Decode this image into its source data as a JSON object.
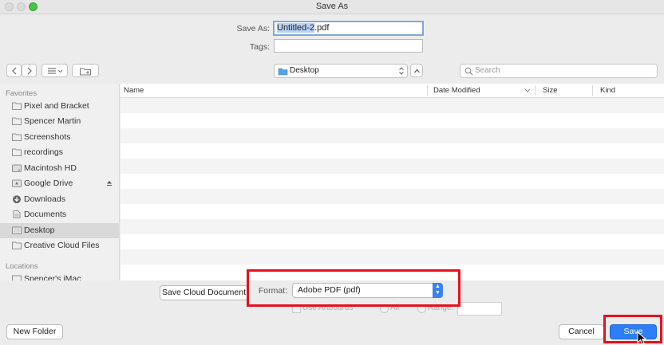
{
  "window": {
    "title": "Save As"
  },
  "save_as": {
    "label": "Save As:",
    "value_selected": "Untitled-2",
    "value_rest": ".pdf"
  },
  "tags": {
    "label": "Tags:",
    "value": ""
  },
  "toolbar": {
    "location": "Desktop",
    "search_placeholder": "Search"
  },
  "sidebar": {
    "favorites_header": "Favorites",
    "locations_header": "Locations",
    "favorites": [
      {
        "label": "Pixel and Bracket",
        "icon": "folder-icon"
      },
      {
        "label": "Spencer Martin",
        "icon": "folder-icon"
      },
      {
        "label": "Screenshots",
        "icon": "folder-icon"
      },
      {
        "label": "recordings",
        "icon": "folder-icon"
      },
      {
        "label": "Macintosh HD",
        "icon": "disk-icon"
      },
      {
        "label": "Google Drive",
        "icon": "drive-icon"
      },
      {
        "label": "Downloads",
        "icon": "download-icon"
      },
      {
        "label": "Documents",
        "icon": "document-icon"
      },
      {
        "label": "Desktop",
        "icon": "desktop-icon",
        "selected": true
      },
      {
        "label": "Creative Cloud Files",
        "icon": "folder-icon"
      }
    ],
    "locations": [
      {
        "label": "Spencer's iMac",
        "icon": "computer-icon"
      }
    ]
  },
  "columns": {
    "name": "Name",
    "date_modified": "Date Modified",
    "size": "Size",
    "kind": "Kind"
  },
  "bottom": {
    "save_cloud_label": "Save Cloud Document",
    "format_label": "Format:",
    "format_value": "Adobe PDF (pdf)",
    "artboards_label": "Use Artboards",
    "all_label": "All",
    "range_label": "Range:",
    "new_folder_label": "New Folder",
    "cancel_label": "Cancel",
    "save_label": "Save"
  },
  "colors": {
    "accent": "#2d7ef7",
    "highlight_box": "#e8101c"
  }
}
